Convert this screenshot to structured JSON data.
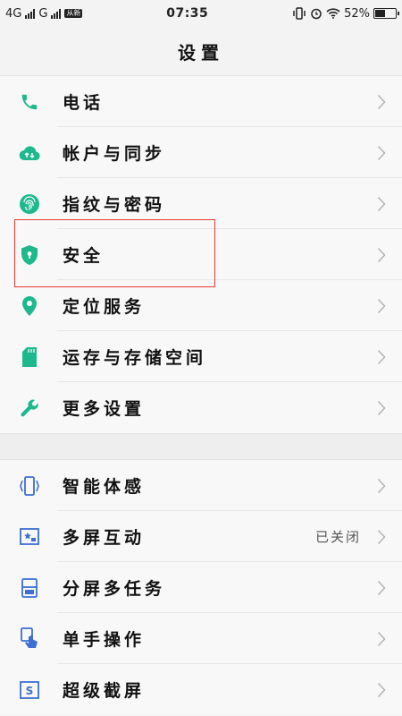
{
  "status": {
    "left1": "4G",
    "left2": "G",
    "badge": "从新",
    "time": "07:35",
    "battery": "52%",
    "battery_level": 0.52
  },
  "title": "设置",
  "groups": [
    [
      {
        "label": "电话",
        "icon": "phone-icon"
      },
      {
        "label": "帐户与同步",
        "icon": "cloud-sync-icon"
      },
      {
        "label": "指纹与密码",
        "icon": "fingerprint-icon"
      },
      {
        "label": "安全",
        "icon": "shield-icon"
      },
      {
        "label": "定位服务",
        "icon": "location-pin-icon"
      },
      {
        "label": "运存与存储空间",
        "icon": "sd-card-icon"
      },
      {
        "label": "更多设置",
        "icon": "wrench-icon"
      }
    ],
    [
      {
        "label": "智能体感",
        "icon": "phone-gesture-icon"
      },
      {
        "label": "多屏互动",
        "icon": "cast-screen-icon",
        "value": "已关闭"
      },
      {
        "label": "分屏多任务",
        "icon": "split-screen-icon"
      },
      {
        "label": "单手操作",
        "icon": "one-hand-icon"
      },
      {
        "label": "超级截屏",
        "icon": "screenshot-icon"
      }
    ]
  ],
  "colors": {
    "green": "#1db98c",
    "blue": "#3d6fd1",
    "highlight": "#e53935"
  }
}
